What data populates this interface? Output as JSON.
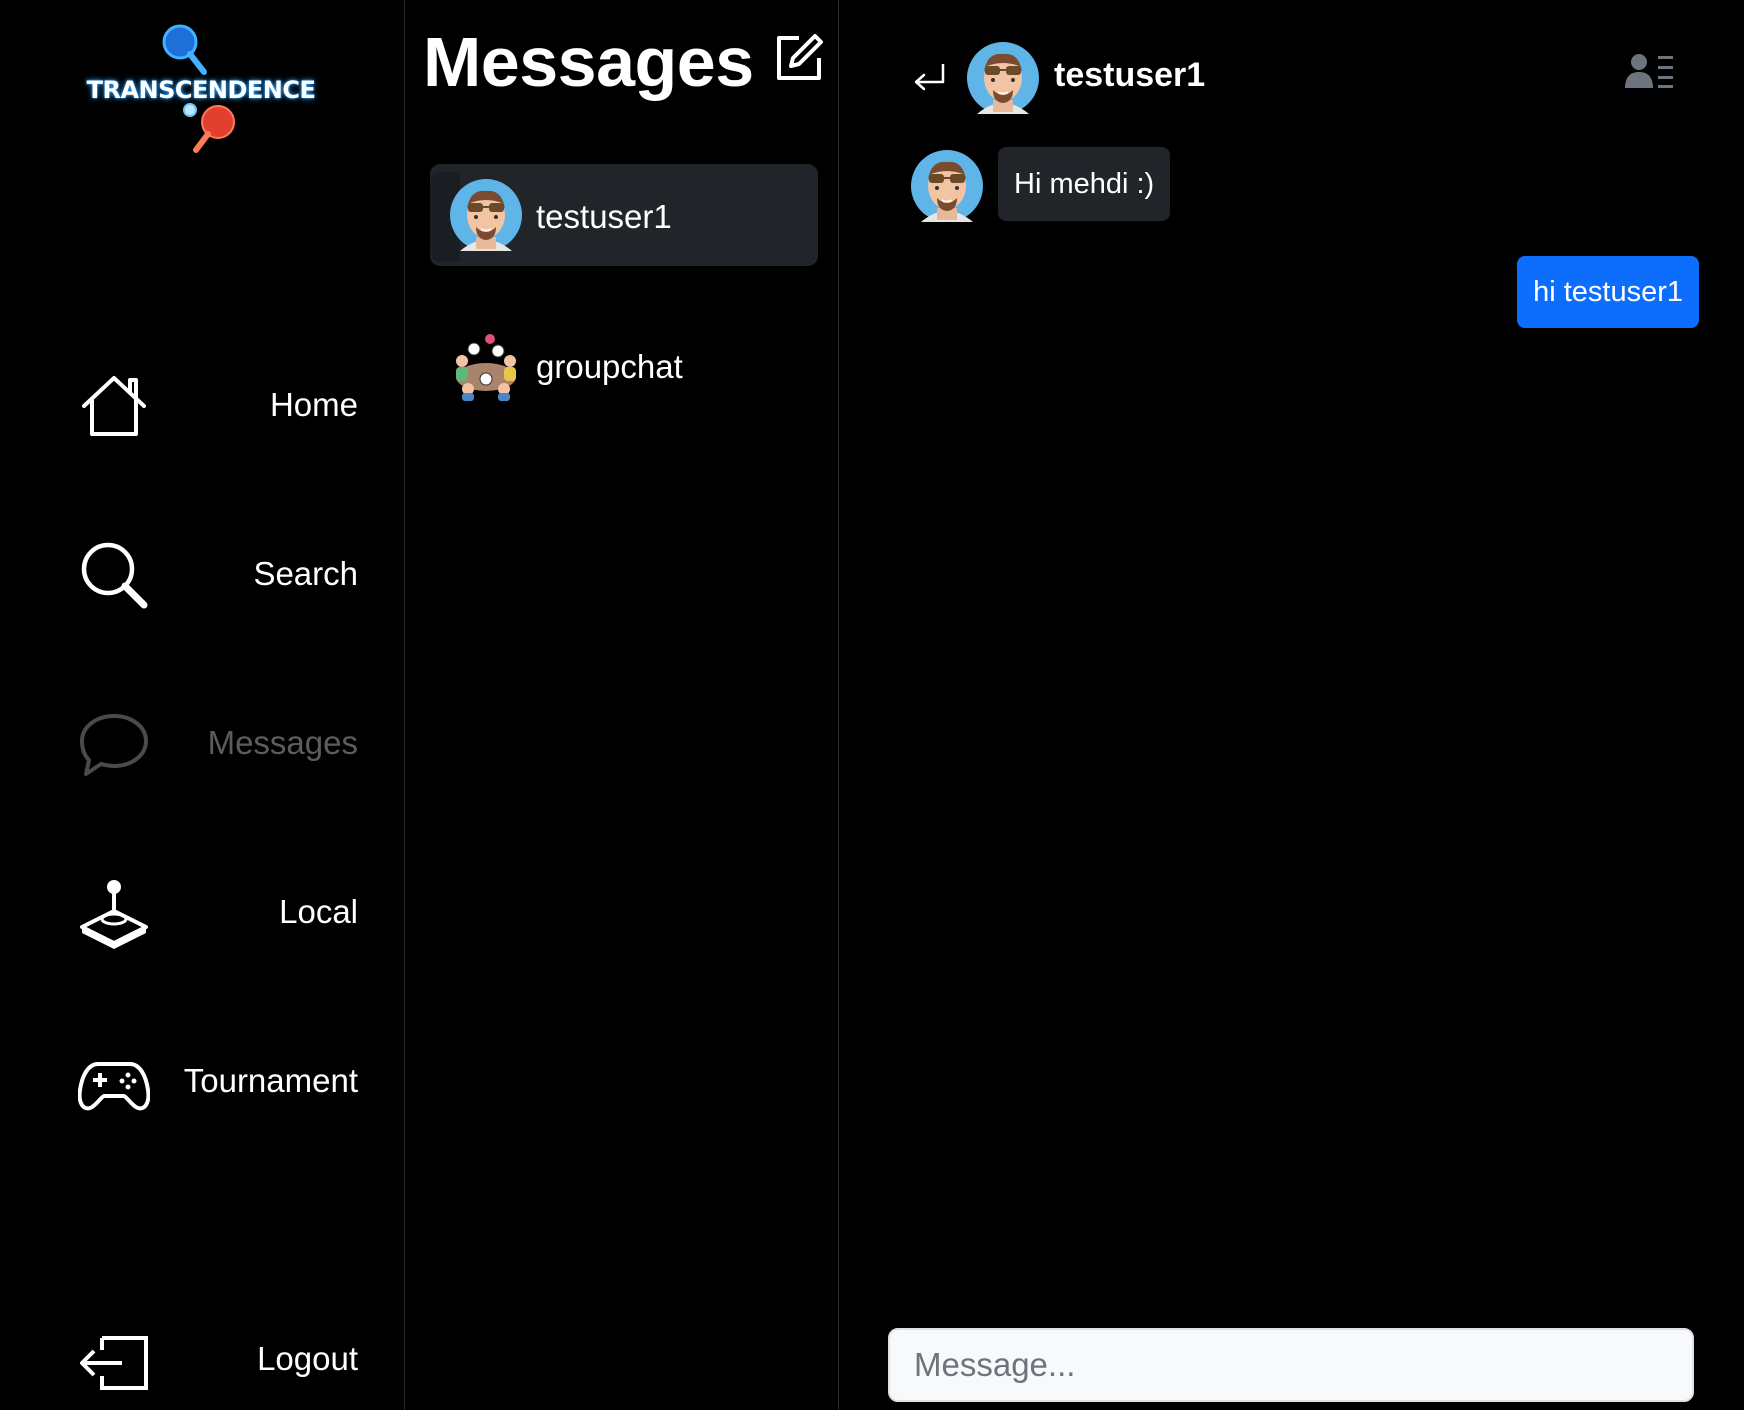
{
  "app": {
    "logo_text": "TRANSCENDENCE"
  },
  "nav": {
    "items": [
      {
        "label": "Home",
        "icon": "home-icon",
        "active": false
      },
      {
        "label": "Search",
        "icon": "search-icon",
        "active": false
      },
      {
        "label": "Messages",
        "icon": "chat-bubble-icon",
        "active": true
      },
      {
        "label": "Local",
        "icon": "joystick-icon",
        "active": false
      },
      {
        "label": "Tournament",
        "icon": "gamepad-icon",
        "active": false
      }
    ],
    "logout_label": "Logout"
  },
  "conversations": {
    "title": "Messages",
    "compose_icon": "compose-icon",
    "items": [
      {
        "name": "testuser1",
        "selected": true,
        "avatar": "user-avatar"
      },
      {
        "name": "groupchat",
        "selected": false,
        "avatar": "group-avatar"
      }
    ]
  },
  "chat": {
    "contact_name": "testuser1",
    "messages": [
      {
        "direction": "incoming",
        "text": "Hi mehdi :)"
      },
      {
        "direction": "outgoing",
        "text": "hi testuser1"
      }
    ],
    "input_placeholder": "Message...",
    "colors": {
      "outgoing_bubble": "#0d6efd",
      "incoming_bubble": "#212529",
      "selected_conversation": "#212529"
    }
  }
}
